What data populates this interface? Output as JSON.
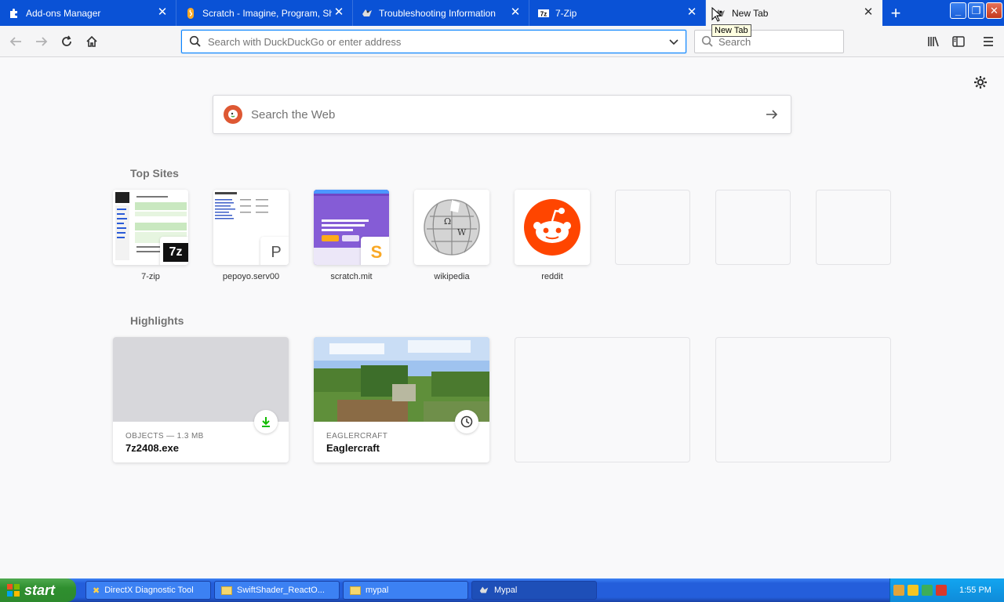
{
  "tabs": [
    {
      "title": "Add-ons Manager",
      "icon": "puzzle-icon"
    },
    {
      "title": "Scratch - Imagine, Program, Share",
      "icon": "scratch-icon"
    },
    {
      "title": "Troubleshooting Information",
      "icon": "mypal-icon"
    },
    {
      "title": "7-Zip",
      "icon": "7zip-icon"
    },
    {
      "title": "New Tab",
      "icon": "mypal-icon",
      "active": true
    }
  ],
  "tooltip": "New Tab",
  "urlbar": {
    "placeholder": "Search with DuckDuckGo or enter address"
  },
  "searchbar": {
    "placeholder": "Search"
  },
  "web_search": {
    "placeholder": "Search the Web"
  },
  "top_sites": {
    "title": "Top Sites",
    "items": [
      {
        "label": "7-zip",
        "badge": "7z"
      },
      {
        "label": "pepoyo.serv00",
        "badge": "P"
      },
      {
        "label": "scratch.mit",
        "badge": "S"
      },
      {
        "label": "wikipedia"
      },
      {
        "label": "reddit"
      }
    ]
  },
  "highlights": {
    "title": "Highlights",
    "items": [
      {
        "context": "OBJECTS — 1.3 MB",
        "title": "7z2408.exe",
        "icon": "download-icon"
      },
      {
        "context": "EAGLERCRAFT",
        "title": "Eaglercraft",
        "icon": "clock-icon"
      }
    ]
  },
  "taskbar": {
    "start": "start",
    "tasks": [
      {
        "label": "DirectX Diagnostic Tool"
      },
      {
        "label": "SwiftShader_ReactO..."
      },
      {
        "label": "mypal"
      },
      {
        "label": "Mypal",
        "active": true
      }
    ],
    "clock": "1:55 PM"
  },
  "colors": {
    "tabbar": "#0a52d6",
    "accent": "#0a84ff",
    "reddit": "#ff4500",
    "ddg": "#de5833"
  }
}
